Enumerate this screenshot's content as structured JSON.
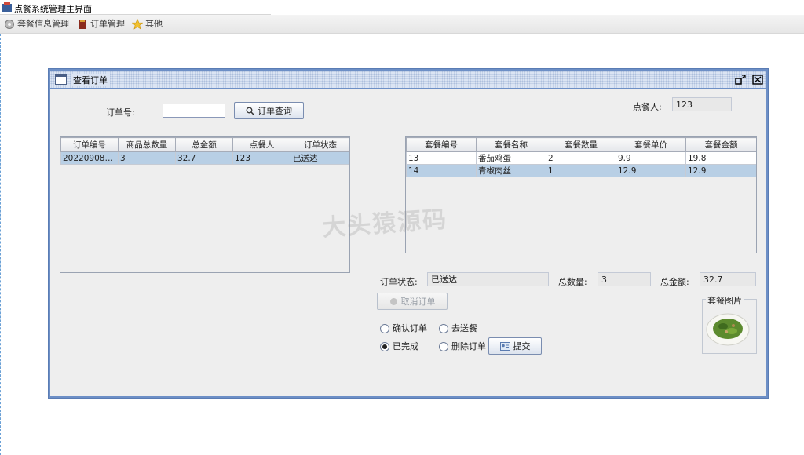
{
  "app": {
    "title": "点餐系统管理主界面"
  },
  "menu": [
    {
      "label": "套餐信息管理",
      "icon": "gear-icon"
    },
    {
      "label": "订单管理",
      "icon": "clipboard-icon"
    },
    {
      "label": "其他",
      "icon": "star-icon"
    }
  ],
  "frame": {
    "title": "查看订单"
  },
  "search": {
    "order_no_label": "订单号:",
    "order_no_value": "",
    "query_button": "订单查询"
  },
  "customer": {
    "label": "点餐人:",
    "value": "123"
  },
  "orders_table": {
    "headers": [
      "订单编号",
      "商品总数量",
      "总金额",
      "点餐人",
      "订单状态"
    ],
    "rows": [
      [
        "2022090812...",
        "3",
        "32.7",
        "123",
        "已送达"
      ]
    ]
  },
  "items_table": {
    "headers": [
      "套餐编号",
      "套餐名称",
      "套餐数量",
      "套餐单价",
      "套餐金额"
    ],
    "rows": [
      [
        "13",
        "番茄鸡蛋",
        "2",
        "9.9",
        "19.8"
      ],
      [
        "14",
        "青椒肉丝",
        "1",
        "12.9",
        "12.9"
      ]
    ]
  },
  "status": {
    "label": "订单状态:",
    "value": "已送达"
  },
  "total_qty": {
    "label": "总数量:",
    "value": "3"
  },
  "total_amount": {
    "label": "总金额:",
    "value": "32.7"
  },
  "cancel_button": "取消订单",
  "image_group": {
    "caption": "套餐图片"
  },
  "radios": [
    {
      "label": "确认订单",
      "checked": false
    },
    {
      "label": "去送餐",
      "checked": false
    },
    {
      "label": "已完成",
      "checked": true
    },
    {
      "label": "删除订单",
      "checked": false
    }
  ],
  "submit_button": "提交",
  "watermark": "大头猿源码"
}
